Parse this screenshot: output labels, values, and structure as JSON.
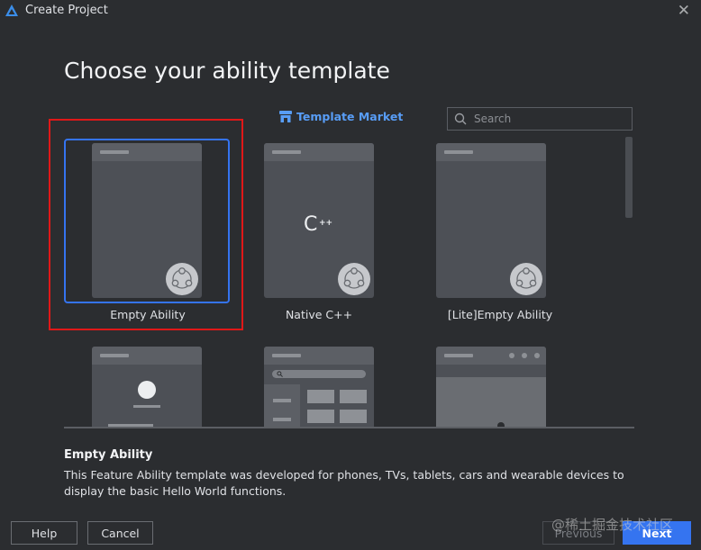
{
  "window": {
    "title": "Create Project",
    "close_glyph": "✕"
  },
  "heading": "Choose your ability template",
  "market": {
    "label": "Template Market",
    "icon": "store-icon"
  },
  "search": {
    "placeholder": "Search",
    "value": ""
  },
  "templates": [
    {
      "label": "Empty Ability",
      "selected": true,
      "art": "badge"
    },
    {
      "label": "Native C++",
      "selected": false,
      "art": "cpp-badge",
      "cpp_glyph": "C",
      "cpp_plus": "++"
    },
    {
      "label": "[Lite]Empty Ability",
      "selected": false,
      "art": "badge"
    },
    {
      "label": "",
      "selected": false,
      "art": "avatar"
    },
    {
      "label": "",
      "selected": false,
      "art": "search-grid"
    },
    {
      "label": "",
      "selected": false,
      "art": "dots"
    }
  ],
  "description": {
    "title": "Empty Ability",
    "text": "This Feature Ability template was developed for phones, TVs, tablets, cars and wearable devices to display the basic Hello World functions."
  },
  "buttons": {
    "help": "Help",
    "cancel": "Cancel",
    "previous": "Previous",
    "next": "Next"
  },
  "watermark": "@稀土掘金技术社区",
  "colors": {
    "accent": "#3574f0",
    "highlight_box": "#e01818",
    "link": "#589df6",
    "background": "#2b2d30"
  }
}
